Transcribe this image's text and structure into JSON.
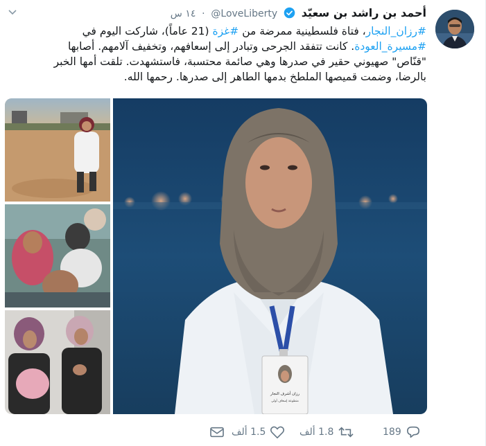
{
  "author": {
    "display_name": "أحمد بن راشد بن سعيّد",
    "handle": "@LoveLiberty",
    "time": "١٤ س",
    "avatar_icon": "user-avatar"
  },
  "tweet": {
    "line1_hashtag1": "#رزان_النجار",
    "line1_text1": "، فتاة فلسطينية ممرضة من ",
    "line1_hashtag2": "#غزة",
    "line1_text2": " (21 عاماً)، شاركت اليوم في",
    "line2_hashtag": "#مسيرة_العودة",
    "line2_text": ". كانت تتفقد الجرحى وتبادر إلى إسعافهم، وتخفيف آلامهم. أصابها",
    "line3": "\"قنّاص\" صهيوني حقير في صدرها وهي صائمة محتسبة، فاستشهدت. تلقت أمها الخبر",
    "line4": "بالرضا، وضمت قميصها الملطخ بدمها الطاهر إلى صدرها. رحمها الله."
  },
  "media": {
    "badge_name": "رزان أشرف النجار",
    "badge_subtitle": "متطوعة إسعاف أولي"
  },
  "actions": {
    "reply_count": "189",
    "retweet_count": "1.8 ألف",
    "like_count": "1.5 ألف"
  },
  "colors": {
    "accent": "#1da1f2",
    "text": "#14171a",
    "muted": "#657786"
  }
}
